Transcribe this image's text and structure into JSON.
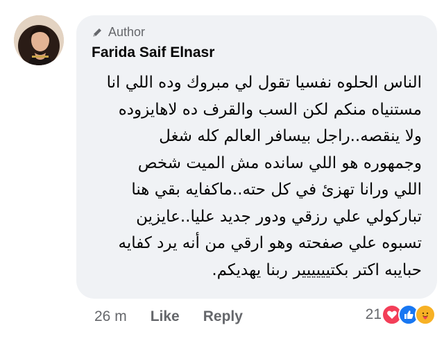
{
  "comment": {
    "badge_label": "Author",
    "author_name": "Farida Saif Elnasr",
    "text_lines": [
      "الناس الحلوه نفسيا تقول لي مبروك وده اللي انا",
      "مستنياه منكم لكن السب والقرف ده لاهايزوده",
      "ولا ينقصه..راجل بيسافر العالم كله شغل",
      "وجمهوره هو اللي سانده مش الميت شخص",
      "اللي ورانا تهزئ في كل حته..ماكفايه بقي هنا",
      "تباركولي علي رزقي ودور جديد عليا..عايزين",
      "تسبوه علي صفحته وهو ارقي من أنه يرد كفايه",
      "حبايبه اكتر بكتيييييير ربنا يهديكم."
    ],
    "timestamp": "26 m",
    "like_label": "Like",
    "reply_label": "Reply",
    "reaction_count": "21",
    "reactions": [
      "love",
      "like",
      "care"
    ]
  },
  "colors": {
    "bubble": "#f0f2f5",
    "secondary_text": "#65676b",
    "love": "#f33e58",
    "like": "#1877f2",
    "care": "#f7b125"
  }
}
